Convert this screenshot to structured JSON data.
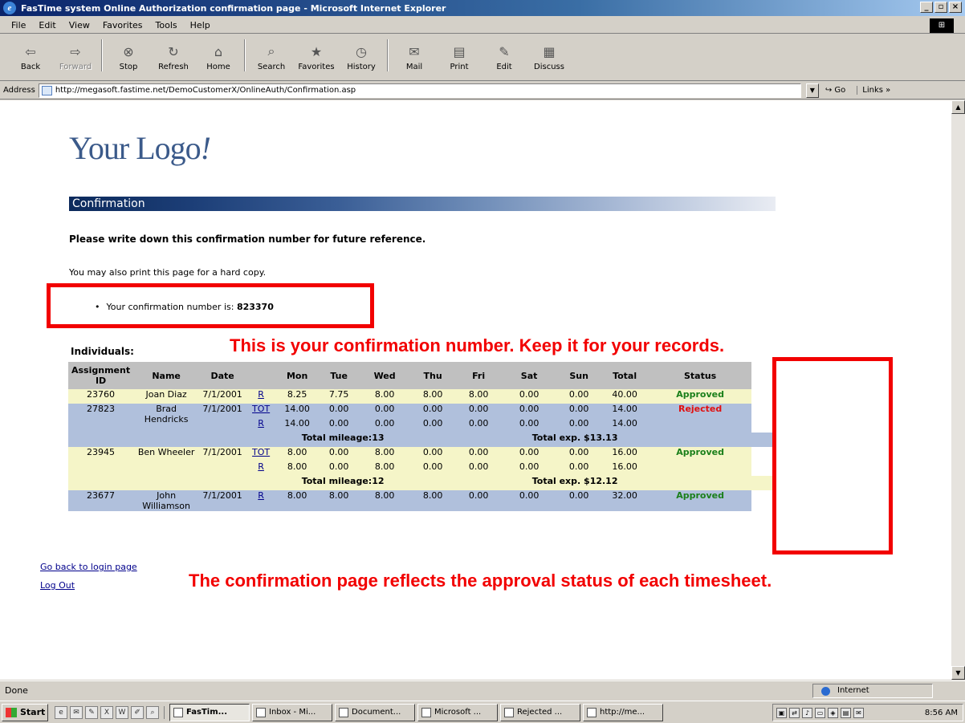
{
  "window": {
    "title": "FasTime system Online Authorization confirmation page - Microsoft Internet Explorer"
  },
  "menu": [
    "File",
    "Edit",
    "View",
    "Favorites",
    "Tools",
    "Help"
  ],
  "toolbar": [
    {
      "label": "Back",
      "icon": "back-arrow-icon",
      "disabled": false
    },
    {
      "label": "Forward",
      "icon": "forward-arrow-icon",
      "disabled": true
    },
    {
      "label": "Stop",
      "icon": "stop-icon",
      "disabled": false
    },
    {
      "label": "Refresh",
      "icon": "refresh-icon",
      "disabled": false
    },
    {
      "label": "Home",
      "icon": "home-icon",
      "disabled": false
    },
    {
      "label": "Search",
      "icon": "search-icon",
      "disabled": false
    },
    {
      "label": "Favorites",
      "icon": "favorites-icon",
      "disabled": false
    },
    {
      "label": "History",
      "icon": "history-icon",
      "disabled": false
    },
    {
      "label": "Mail",
      "icon": "mail-icon",
      "disabled": false
    },
    {
      "label": "Print",
      "icon": "print-icon",
      "disabled": false
    },
    {
      "label": "Edit",
      "icon": "edit-icon",
      "disabled": false
    },
    {
      "label": "Discuss",
      "icon": "discuss-icon",
      "disabled": false
    }
  ],
  "address": {
    "label": "Address",
    "url": "http://megasoft.fastime.net/DemoCustomerX/OnlineAuth/Confirmation.asp",
    "go": "Go",
    "links": "Links »"
  },
  "page": {
    "logo": "Your Logo",
    "logo_excl": "!",
    "section_title": "Confirmation",
    "instruction": "Please write down this confirmation number for future reference.",
    "print_note": "You may also print this page for a hard copy.",
    "confirmation_label": "Your confirmation number is:",
    "confirmation_number": "823370",
    "callout_top": "This is your confirmation number.  Keep it for your records.",
    "individuals_heading": "Individuals:",
    "callout_bottom": "The confirmation page reflects the approval status of each timesheet.",
    "links": {
      "back_to_login": "Go back to login page",
      "logout": "Log Out"
    }
  },
  "table": {
    "headers": [
      "Assignment ID",
      "Name",
      "Date",
      "",
      "Mon",
      "Tue",
      "Wed",
      "Thu",
      "Fri",
      "Sat",
      "Sun",
      "Total",
      "Status"
    ],
    "groups": [
      {
        "id": "23760",
        "name": "Joan Diaz",
        "date": "7/1/2001",
        "status": "Approved",
        "status_color": "#1a7f1a",
        "band": "yellow",
        "lines": [
          {
            "code": "R",
            "mon": "8.25",
            "tue": "7.75",
            "wed": "8.00",
            "thu": "8.00",
            "fri": "8.00",
            "sat": "0.00",
            "sun": "0.00",
            "total": "40.00"
          }
        ]
      },
      {
        "id": "27823",
        "name": "Brad Hendricks",
        "date": "7/1/2001",
        "status": "Rejected",
        "status_color": "#e01010",
        "band": "blue",
        "lines": [
          {
            "code": "TOT",
            "mon": "14.00",
            "tue": "0.00",
            "wed": "0.00",
            "thu": "0.00",
            "fri": "0.00",
            "sat": "0.00",
            "sun": "0.00",
            "total": "14.00"
          },
          {
            "code": "R",
            "mon": "14.00",
            "tue": "0.00",
            "wed": "0.00",
            "thu": "0.00",
            "fri": "0.00",
            "sat": "0.00",
            "sun": "0.00",
            "total": "14.00"
          }
        ],
        "mileage": "Total mileage:13",
        "expense": "Total exp. $13.13"
      },
      {
        "id": "23945",
        "name": "Ben Wheeler",
        "date": "7/1/2001",
        "status": "Approved",
        "status_color": "#1a7f1a",
        "band": "yellow",
        "lines": [
          {
            "code": "TOT",
            "mon": "8.00",
            "tue": "0.00",
            "wed": "8.00",
            "thu": "0.00",
            "fri": "0.00",
            "sat": "0.00",
            "sun": "0.00",
            "total": "16.00"
          },
          {
            "code": "R",
            "mon": "8.00",
            "tue": "0.00",
            "wed": "8.00",
            "thu": "0.00",
            "fri": "0.00",
            "sat": "0.00",
            "sun": "0.00",
            "total": "16.00"
          }
        ],
        "mileage": "Total mileage:12",
        "expense": "Total exp. $12.12"
      },
      {
        "id": "23677",
        "name": "John Williamson",
        "date": "7/1/2001",
        "status": "Approved",
        "status_color": "#1a7f1a",
        "band": "blue",
        "lines": [
          {
            "code": "R",
            "mon": "8.00",
            "tue": "8.00",
            "wed": "8.00",
            "thu": "8.00",
            "fri": "0.00",
            "sat": "0.00",
            "sun": "0.00",
            "total": "32.00"
          }
        ]
      }
    ]
  },
  "statusbar": {
    "left": "Done",
    "zone": "Internet"
  },
  "taskbar": {
    "start": "Start",
    "tasks": [
      {
        "label": "FasTim...",
        "active": true
      },
      {
        "label": "Inbox - Mi...",
        "active": false
      },
      {
        "label": "Document...",
        "active": false
      },
      {
        "label": "Microsoft ...",
        "active": false
      },
      {
        "label": "Rejected ...",
        "active": false
      },
      {
        "label": "http://me...",
        "active": false
      }
    ],
    "clock": "8:56 AM"
  },
  "colors": {
    "callout": "#f20000",
    "row_yellow": "#f5f5c8",
    "row_blue": "#b0c0dc",
    "approved": "#1a7f1a",
    "rejected": "#e01010"
  }
}
